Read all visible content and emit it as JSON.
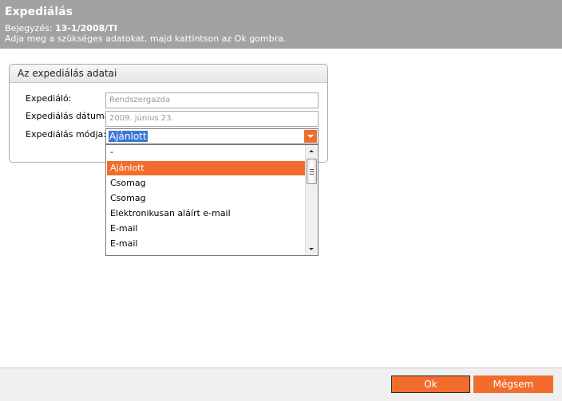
{
  "header": {
    "title": "Expediálás",
    "entry_label": "Bejegyzés:",
    "entry_value": "13-1/2008/TI",
    "hint": "Adja meg a szükséges adatokat, majd kattintson az Ok gombra."
  },
  "panel": {
    "title": "Az expediálás adatai",
    "fields": {
      "expedialo_label": "Expediáló:",
      "expedialo_value": "Rendszergazda",
      "datum_label": "Expediálás dátuma:",
      "datum_value": "2009. június 23.",
      "mod_label": "Expediálás módja:",
      "mod_value": "Ajánlott"
    }
  },
  "dropdown": {
    "items": [
      "-",
      "Ajánlott",
      "Csomag",
      "Csomag",
      "Elektronikusan aláírt e-mail",
      "E-mail",
      "E-mail"
    ],
    "selected_index": 1
  },
  "footer": {
    "ok_label": "Ok",
    "cancel_label": "Mégsem"
  },
  "colors": {
    "accent": "#f26d2d",
    "header_bg": "#a2a2a2",
    "selection_blue": "#3875d7"
  },
  "icons": {
    "select_arrow": "chevron-down-icon",
    "scroll_up": "arrow-up-icon",
    "scroll_down": "arrow-down-icon"
  }
}
